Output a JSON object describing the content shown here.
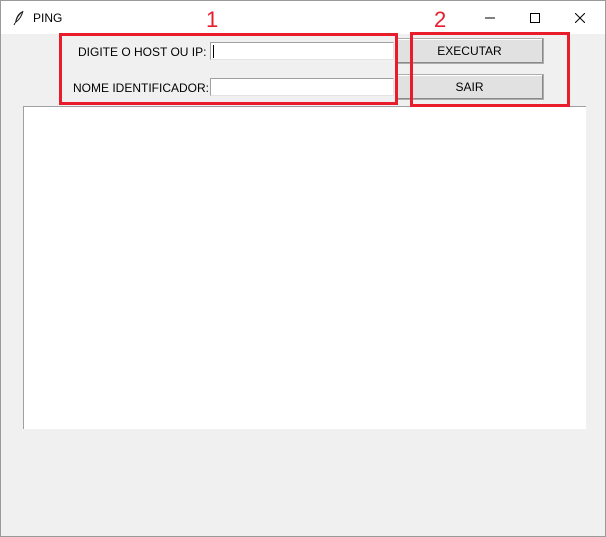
{
  "window": {
    "title": "PING",
    "icon": "feather-icon"
  },
  "form": {
    "host_label": "DIGITE O HOST OU IP:",
    "host_value": "",
    "name_label": "NOME IDENTIFICADOR:",
    "name_value": ""
  },
  "buttons": {
    "execute": "EXECUTAR",
    "exit": "SAIR"
  },
  "annotations": {
    "group1": "1",
    "group2": "2",
    "color": "#e81c2b"
  },
  "output": {
    "text": ""
  }
}
